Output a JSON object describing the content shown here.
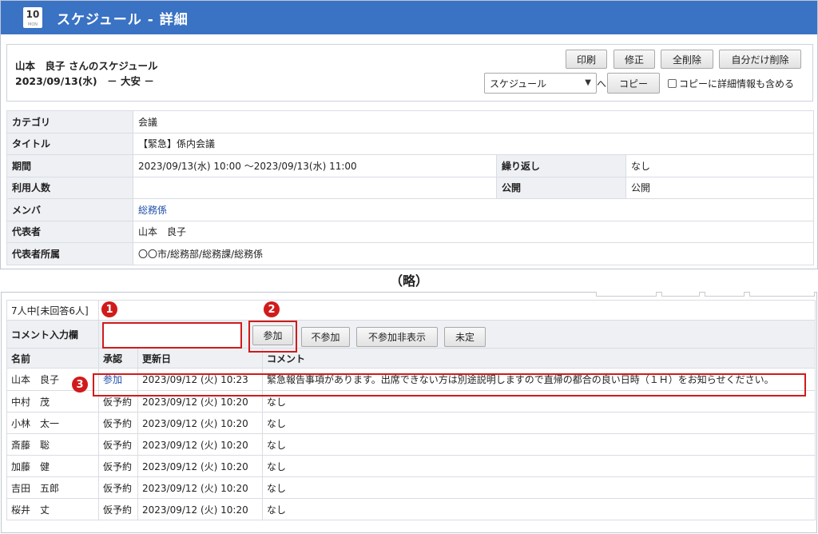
{
  "header": {
    "calendar_icon_day": "10",
    "calendar_icon_dow": "MON",
    "title": "スケジュール - 詳細"
  },
  "info": {
    "owner_line": "山本　良子 さんのスケジュール",
    "date_line": "2023/09/13(水)　－ 大安 －"
  },
  "toolbar": {
    "print_label": "印刷",
    "edit_label": "修正",
    "delete_all_label": "全削除",
    "delete_self_label": "自分だけ削除",
    "target_select_value": "スケジュール",
    "to_label": "へ",
    "copy_label": "コピー",
    "include_detail_label": "コピーに詳細情報も含める"
  },
  "details": {
    "category_label": "カテゴリ",
    "category_value": "会議",
    "title_label": "タイトル",
    "title_value": "【緊急】係内会議",
    "period_label": "期間",
    "period_value": "2023/09/13(水) 10:00 ～2023/09/13(水) 11:00",
    "repeat_label": "繰り返し",
    "repeat_value": "なし",
    "users_label": "利用人数",
    "users_value": "",
    "public_label": "公開",
    "public_value": "公開",
    "member_label": "メンバ",
    "member_value": "総務係",
    "rep_label": "代表者",
    "rep_value": "山本　良子",
    "dept_label": "代表者所属",
    "dept_value": "〇〇市/総務部/総務課/総務係"
  },
  "omitted_label": "（略）",
  "attendance": {
    "summary": "7人中[未回答6人]",
    "comment_label": "コメント入力欄",
    "comment_input_value": "",
    "join_label": "参加",
    "decline_label": "不参加",
    "decline_hide_label": "不参加非表示",
    "undecided_label": "未定",
    "columns": {
      "name": "名前",
      "approval": "承認",
      "updated": "更新日",
      "comment": "コメント"
    },
    "rows": [
      {
        "name": "山本　良子",
        "approval": "参加",
        "updated": "2023/09/12 (火) 10:23",
        "comment": "緊急報告事項があります。出席できない方は別途説明しますので直帰の都合の良い日時（１Ｈ）をお知らせください。"
      },
      {
        "name": "中村　茂",
        "approval": "仮予約",
        "updated": "2023/09/12 (火) 10:20",
        "comment": "なし"
      },
      {
        "name": "小林　太一",
        "approval": "仮予約",
        "updated": "2023/09/12 (火) 10:20",
        "comment": "なし"
      },
      {
        "name": "斎藤　聡",
        "approval": "仮予約",
        "updated": "2023/09/12 (火) 10:20",
        "comment": "なし"
      },
      {
        "name": "加藤　健",
        "approval": "仮予約",
        "updated": "2023/09/12 (火) 10:20",
        "comment": "なし"
      },
      {
        "name": "吉田　五郎",
        "approval": "仮予約",
        "updated": "2023/09/12 (火) 10:20",
        "comment": "なし"
      },
      {
        "name": "桜井　丈",
        "approval": "仮予約",
        "updated": "2023/09/12 (火) 10:20",
        "comment": "なし"
      }
    ]
  },
  "callouts": {
    "one": "1",
    "two": "2",
    "three": "3"
  },
  "colors": {
    "header_bg": "#3a72c4",
    "callout_red": "#d11b1b",
    "link_blue": "#1f4fa8",
    "label_bg": "#eef0f4"
  }
}
